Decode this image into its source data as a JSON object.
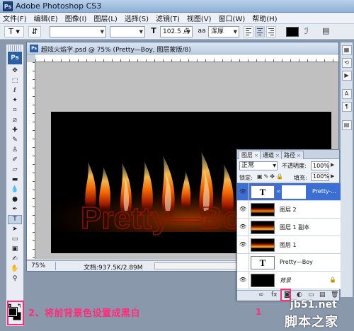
{
  "app": {
    "title": "Adobe Photoshop CS3",
    "logo_text": "Ps"
  },
  "menu": [
    "文件(F)",
    "编辑(E)",
    "图像(I)",
    "图层(L)",
    "选择(S)",
    "滤镜(T)",
    "视图(V)",
    "窗口(W)",
    "帮助(H)"
  ],
  "options": {
    "tool_glyph": "T",
    "font_size": "102.5 点",
    "anti_alias_label": "aa",
    "anti_alias": "浑厚",
    "text_color": "#000000"
  },
  "document": {
    "title": "超炫火焰字.psd @ 75% (Pretty—Boy, 图层蒙版/8)",
    "zoom": "75%",
    "doc_info": "文档:937.5K/2.89M",
    "canvas_text": "Pretty—Boy"
  },
  "layers_panel": {
    "tabs": [
      "图层",
      "通道",
      "路径"
    ],
    "blend_mode": "正常",
    "opacity_label": "不透明度:",
    "opacity": "100%",
    "lock_label": "锁定:",
    "fill_label": "填充:",
    "fill": "100%",
    "layers": [
      {
        "name": "Pretty-...",
        "thumb": "T",
        "selected": true,
        "has_mask": true
      },
      {
        "name": "图层 2",
        "thumb": "fire",
        "selected": false
      },
      {
        "name": "图层 1 副本",
        "thumb": "fire2",
        "selected": false
      },
      {
        "name": "图层 1",
        "thumb": "fire2",
        "selected": false
      },
      {
        "name": "Pretty—Boy",
        "thumb": "T",
        "selected": false
      },
      {
        "name": "背景",
        "thumb": "black",
        "selected": false,
        "locked": true
      }
    ]
  },
  "annotations": {
    "step2": "2、将前背景色设置成黑白",
    "step1": "1"
  },
  "watermark": {
    "url": "jb51.net",
    "site": "脚本之家"
  },
  "colors": {
    "annotation": "#ff2c7a",
    "selected_layer": "#3b6fd6"
  }
}
